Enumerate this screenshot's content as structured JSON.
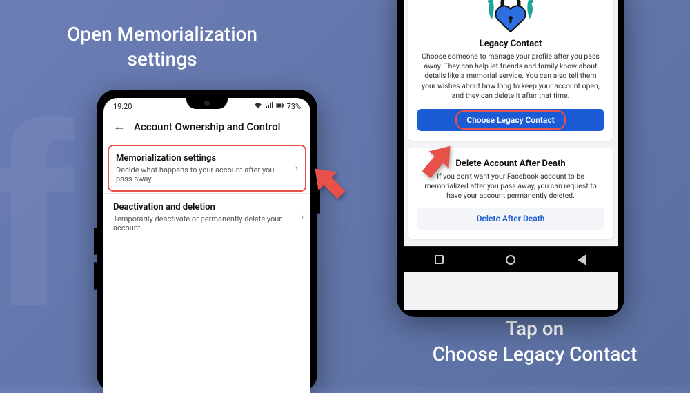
{
  "captions": {
    "left": "Open Memorialization settings",
    "right": "Tap on\nChoose Legacy Contact"
  },
  "phone_left": {
    "status": {
      "time": "19:20",
      "battery": "73%"
    },
    "header": "Account Ownership and Control",
    "settings": [
      {
        "title": "Memorialization settings",
        "desc": "Decide what happens to your account after you pass away.",
        "highlighted": true
      },
      {
        "title": "Deactivation and deletion",
        "desc": "Temporarily deactivate or permanently delete your account.",
        "highlighted": false
      }
    ]
  },
  "phone_right": {
    "legacy": {
      "title": "Legacy Contact",
      "desc": "Choose someone to manage your profile after you pass away. They can help let friends and family know about details like a memorial service. You can also tell them your wishes about how long to keep your account open, and they can delete it after that time.",
      "button": "Choose Legacy Contact"
    },
    "delete": {
      "title": "Delete Account After Death",
      "desc": "If you don't want your Facebook account to be memorialized after you pass away, you can request to have your account permanently deleted.",
      "button": "Delete After Death"
    }
  },
  "colors": {
    "highlight": "#e8504a",
    "primary": "#1b5bd6"
  }
}
